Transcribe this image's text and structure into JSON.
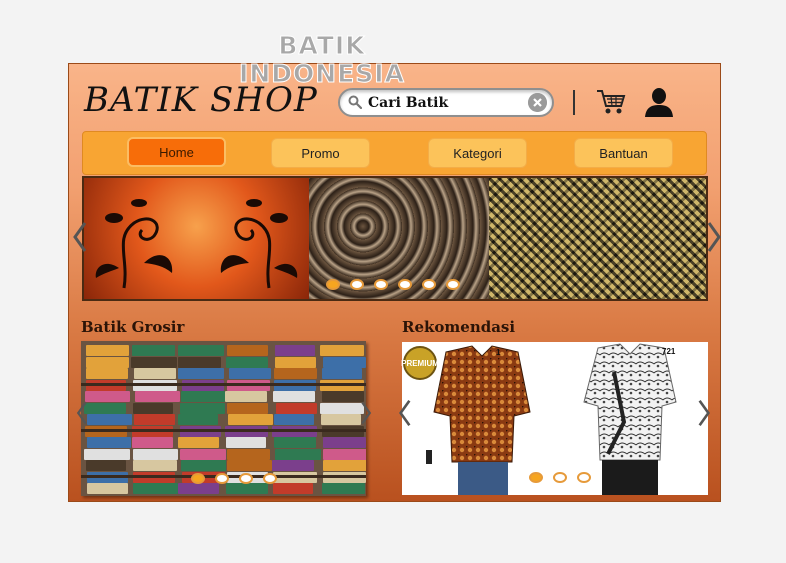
{
  "header": {
    "logo": "BATIK SHOP"
  },
  "search": {
    "placeholder": "Cari Batik",
    "value": ""
  },
  "nav": {
    "tabs": [
      {
        "label": "Home",
        "active": true
      },
      {
        "label": "Promo",
        "active": false
      },
      {
        "label": "Kategori",
        "active": false
      },
      {
        "label": "Bantuan",
        "active": false
      }
    ]
  },
  "banner": {
    "text_line1": "BATIK",
    "text_line2": "INDONESIA",
    "slides": 6,
    "active_slide": 1
  },
  "grosir": {
    "title": "Batik Grosir",
    "slides": 4,
    "active_slide": 1
  },
  "rekomendasi": {
    "title": "Rekomendasi",
    "badge": "PREMIUM",
    "items": [
      {
        "label": "1"
      },
      {
        "label": "721"
      }
    ],
    "slides": 3,
    "active_slide": 1
  },
  "icons": {
    "search": "search-icon",
    "clear": "clear-icon",
    "cart": "cart-icon",
    "user": "user-icon",
    "prev": "chevron-left-icon",
    "next": "chevron-right-icon"
  },
  "colors": {
    "nav_bg": "#f8a533",
    "active_tab": "#f76d09",
    "tab": "#fcc35a",
    "frame_top": "#f9b489",
    "frame_bottom": "#b9511f"
  }
}
